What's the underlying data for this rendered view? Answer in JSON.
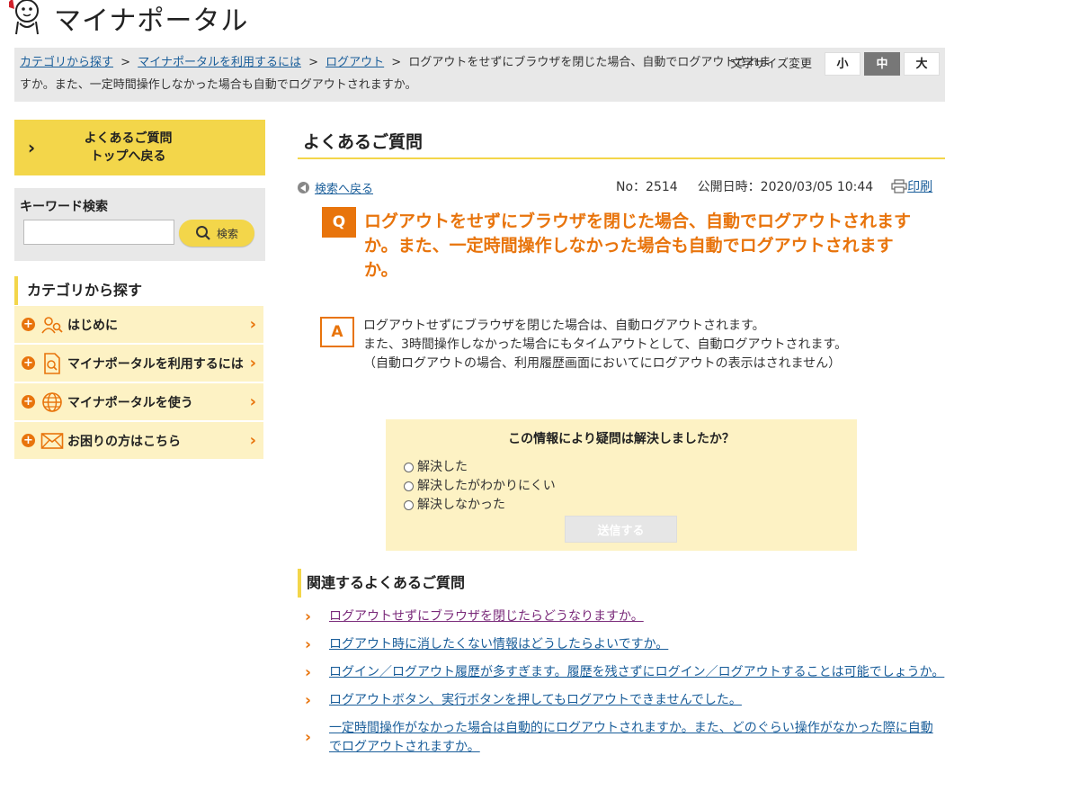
{
  "header": {
    "logo_text": "マイナポータル"
  },
  "breadcrumb": {
    "items": [
      {
        "label": "カテゴリから探す"
      },
      {
        "label": "マイナポータルを利用するには"
      },
      {
        "label": "ログアウト"
      }
    ],
    "separator": ">",
    "current_line1": "ログアウトをせずにブラウザを閉じた場合、自動でログアウトされま",
    "current_line2": "すか。また、一定時間操作しなかった場合も自動でログアウトされますか。"
  },
  "font_size": {
    "label": "文字サイズ変更",
    "options": [
      "小",
      "中",
      "大"
    ],
    "selected": "中"
  },
  "sidebar": {
    "top_button": {
      "line1": "よくあるご質問",
      "line2": "トップへ戻る"
    },
    "keyword": {
      "title": "キーワード検索",
      "value": "",
      "button": "検索"
    },
    "category_title": "カテゴリから探す",
    "categories": [
      {
        "label": "はじめに",
        "icon": "people-search-icon"
      },
      {
        "label": "マイナポータルを利用するには",
        "icon": "document-icon"
      },
      {
        "label": "マイナポータルを使う",
        "icon": "globe-icon"
      },
      {
        "label": "お困りの方はこちら",
        "icon": "mail-icon"
      }
    ]
  },
  "main": {
    "title": "よくあるご質問",
    "back_link": "検索へ戻る",
    "no_label": "No：2514",
    "published": "公開日時：2020/03/05 10:44",
    "print": "印刷",
    "q_badge": "Q",
    "question": "ログアウトをせずにブラウザを閉じた場合、自動でログアウトされますか。また、一定時間操作しなかった場合も自動でログアウトされますか。",
    "a_badge": "A",
    "answer_lines": [
      "ログアウトせずにブラウザを閉じた場合は、自動ログアウトされます。",
      "また、3時間操作しなかった場合にもタイムアウトとして、自動ログアウトされます。",
      "（自動ログアウトの場合、利用履歴画面においてにログアウトの表示はされません）"
    ]
  },
  "survey": {
    "question": "この情報により疑問は解決しましたか？",
    "options": [
      "解決した",
      "解決したがわかりにくい",
      "解決しなかった"
    ],
    "submit": "送信する"
  },
  "related": {
    "title": "関連するよくあるご質問",
    "items": [
      {
        "label": "ログアウトせずにブラウザを閉じたらどうなりますか。"
      },
      {
        "label": "ログアウト時に消したくない情報はどうしたらよいですか。"
      },
      {
        "label": "ログイン／ログアウト履歴が多すぎます。履歴を残さずにログイン／ログアウトすることは可能でしょうか。"
      },
      {
        "label": "ログアウトボタン、実行ボタンを押してもログアウトできませんでした。"
      },
      {
        "label": "一定時間操作がなかった場合は自動的にログアウトされますか。また、どのぐらい操作がなかった際に自動でログアウトされますか。"
      }
    ]
  },
  "colors": {
    "accent_orange": "#e8740c",
    "accent_yellow": "#f3d64a",
    "light_yellow": "#fdf2c4",
    "link_blue": "#1a5e9a"
  }
}
